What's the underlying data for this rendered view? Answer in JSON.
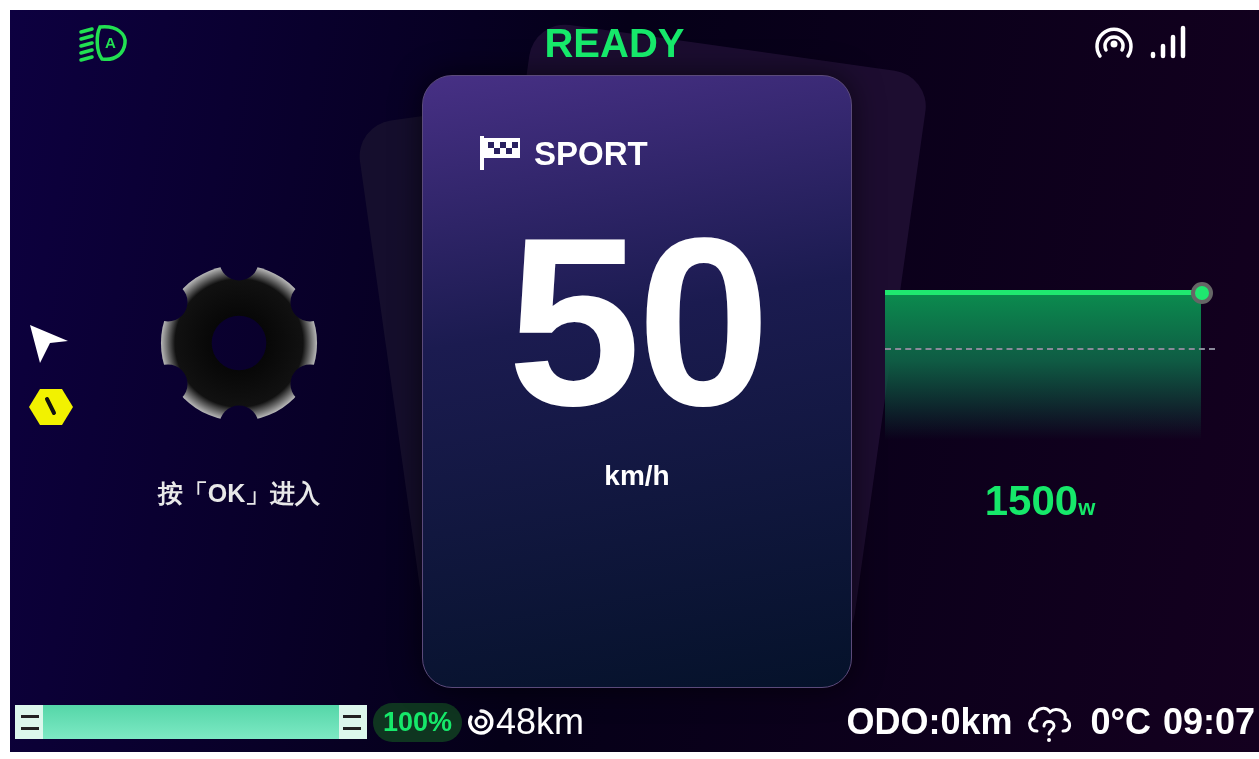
{
  "headlight": {
    "letter": "A"
  },
  "status": {
    "label": "READY"
  },
  "drive_mode": {
    "label": "SPORT"
  },
  "speed": {
    "value": "50",
    "unit": "km/h"
  },
  "settings_prompt": "按「OK」进入",
  "power": {
    "level": 1,
    "value": "1500",
    "unit": "w"
  },
  "battery": {
    "level": 1,
    "percent": "100%"
  },
  "range": "48km",
  "odo": "ODO:0km",
  "temperature": "0°C",
  "time": "09:07"
}
